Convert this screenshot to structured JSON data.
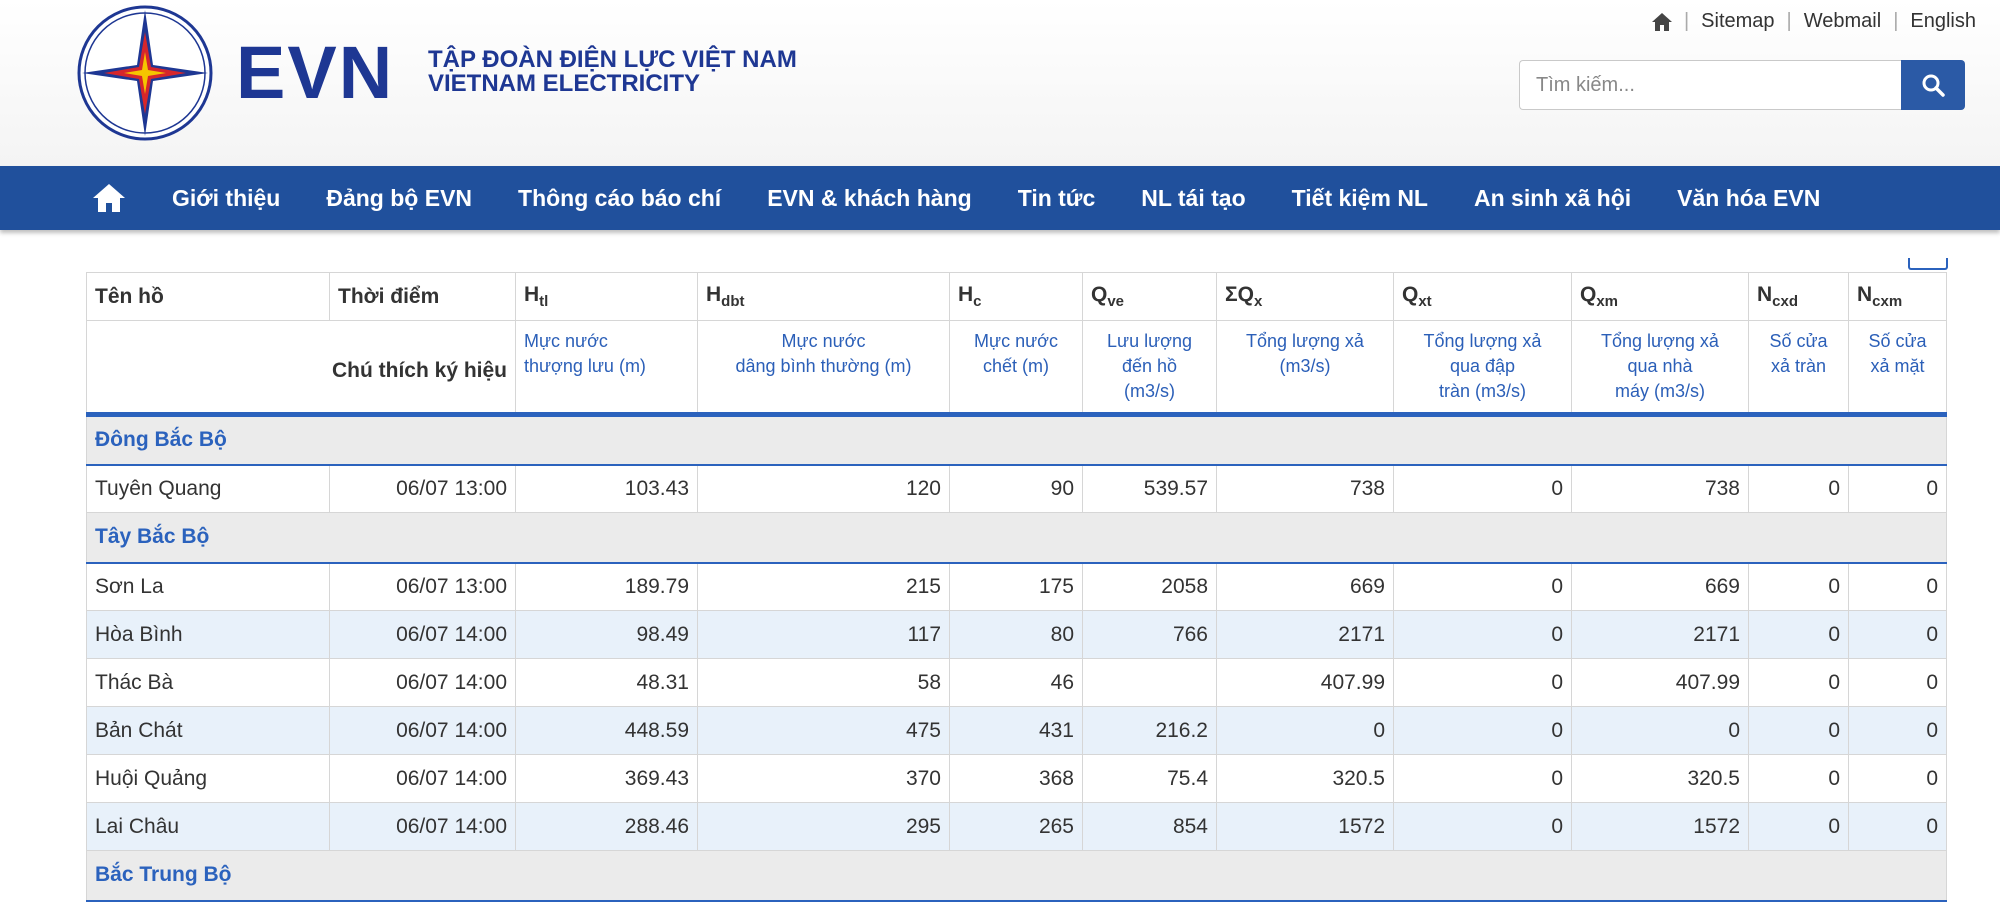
{
  "brand": {
    "logo_text": "EVN",
    "tagline_vi": "TẬP ĐOÀN ĐIỆN LỰC VIỆT NAM",
    "tagline_en": "VIETNAM ELECTRICITY",
    "accent": "#1e3793",
    "star_colors": [
      "#d6262b",
      "#f5c400",
      "#1e3793"
    ]
  },
  "toplinks": {
    "home_icon": "home-icon",
    "sitemap": "Sitemap",
    "webmail": "Webmail",
    "english": "English"
  },
  "search": {
    "placeholder": "Tìm kiếm...",
    "icon": "search-icon"
  },
  "nav": {
    "home_icon": "home-icon",
    "items": [
      "Giới thiệu",
      "Đảng bộ EVN",
      "Thông cáo báo chí",
      "EVN & khách hàng",
      "Tin tức",
      "NL tái tạo",
      "Tiết kiệm NL",
      "An sinh xã hội",
      "Văn hóa EVN"
    ],
    "color": "#20509c"
  },
  "table": {
    "headers": {
      "name": "Tên hồ",
      "time": "Thời điểm",
      "htl": {
        "main": "H",
        "sub": "tl"
      },
      "hdbt": {
        "main": "H",
        "sub": "dbt"
      },
      "hc": {
        "main": "H",
        "sub": "c"
      },
      "qve": {
        "main": "Q",
        "sub": "ve"
      },
      "sqx": {
        "main": "ΣQ",
        "sub": "x"
      },
      "qxt": {
        "main": "Q",
        "sub": "xt"
      },
      "qxm": {
        "main": "Q",
        "sub": "xm"
      },
      "ncxd": {
        "main": "N",
        "sub": "cxd"
      },
      "ncxm": {
        "main": "N",
        "sub": "cxm"
      }
    },
    "legend_label": "Chú thích ký hiệu",
    "legend": {
      "htl": [
        "Mực nước",
        "thượng lưu (m)"
      ],
      "hdbt": [
        "Mực nước",
        "dâng bình thường (m)"
      ],
      "hc": [
        "Mực nước",
        "chết (m)"
      ],
      "qve": [
        "Lưu lượng",
        "đến hồ",
        "(m3/s)"
      ],
      "sqx": [
        "Tổng lượng xả",
        "(m3/s)"
      ],
      "qxt": [
        "Tổng lượng xả",
        "qua đập",
        "tràn (m3/s)"
      ],
      "qxm": [
        "Tổng lượng xả",
        "qua nhà",
        "máy (m3/s)"
      ],
      "ncxd": [
        "Số cửa",
        "xả tràn"
      ],
      "ncxm": [
        "Số cửa",
        "xả mặt"
      ]
    },
    "regions": [
      {
        "name": "Đông Bắc Bộ",
        "rows": [
          {
            "name": "Tuyên Quang",
            "time": "06/07 13:00",
            "htl": "103.43",
            "hdbt": "120",
            "hc": "90",
            "qve": "539.57",
            "sqx": "738",
            "qxt": "0",
            "qxm": "738",
            "ncxd": "0",
            "ncxm": "0"
          }
        ]
      },
      {
        "name": "Tây Bắc Bộ",
        "rows": [
          {
            "name": "Sơn La",
            "time": "06/07 13:00",
            "htl": "189.79",
            "hdbt": "215",
            "hc": "175",
            "qve": "2058",
            "sqx": "669",
            "qxt": "0",
            "qxm": "669",
            "ncxd": "0",
            "ncxm": "0"
          },
          {
            "name": "Hòa Bình",
            "time": "06/07 14:00",
            "htl": "98.49",
            "hdbt": "117",
            "hc": "80",
            "qve": "766",
            "sqx": "2171",
            "qxt": "0",
            "qxm": "2171",
            "ncxd": "0",
            "ncxm": "0"
          },
          {
            "name": "Thác Bà",
            "time": "06/07 14:00",
            "htl": "48.31",
            "hdbt": "58",
            "hc": "46",
            "qve": "",
            "sqx": "407.99",
            "qxt": "0",
            "qxm": "407.99",
            "ncxd": "0",
            "ncxm": "0"
          },
          {
            "name": "Bản Chát",
            "time": "06/07 14:00",
            "htl": "448.59",
            "hdbt": "475",
            "hc": "431",
            "qve": "216.2",
            "sqx": "0",
            "qxt": "0",
            "qxm": "0",
            "ncxd": "0",
            "ncxm": "0"
          },
          {
            "name": "Huội Quảng",
            "time": "06/07 14:00",
            "htl": "369.43",
            "hdbt": "370",
            "hc": "368",
            "qve": "75.4",
            "sqx": "320.5",
            "qxt": "0",
            "qxm": "320.5",
            "ncxd": "0",
            "ncxm": "0"
          },
          {
            "name": "Lai Châu",
            "time": "06/07 14:00",
            "htl": "288.46",
            "hdbt": "295",
            "hc": "265",
            "qve": "854",
            "sqx": "1572",
            "qxt": "0",
            "qxm": "1572",
            "ncxd": "0",
            "ncxm": "0"
          }
        ]
      },
      {
        "name": "Bắc Trung Bộ",
        "rows": []
      }
    ]
  }
}
